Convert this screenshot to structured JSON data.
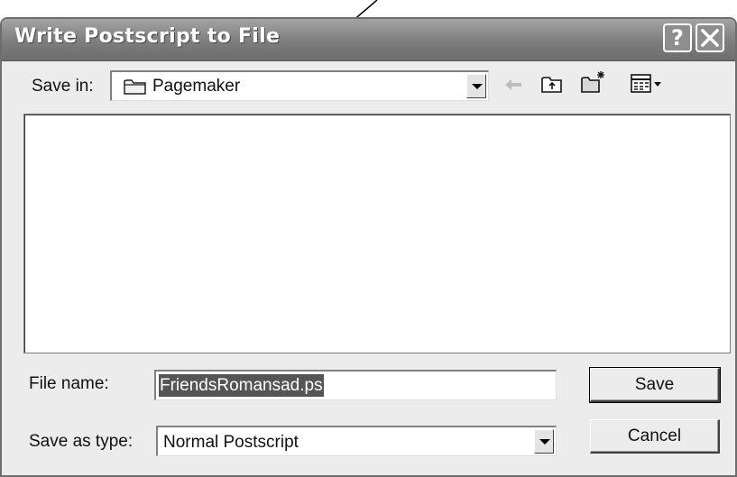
{
  "window": {
    "title": "Write Postscript to File",
    "help_label": "?"
  },
  "toolbar": {
    "save_in_label": "Save in:",
    "save_in_value": "Pagemaker",
    "icons": [
      "folder-icon",
      "back-arrow-icon",
      "up-one-level-icon",
      "create-new-folder-icon",
      "view-menu-icon"
    ]
  },
  "file_list": {
    "items": []
  },
  "form": {
    "file_name_label": "File name:",
    "file_name_value": "FriendsRomansad.ps",
    "save_as_type_label": "Save as type:",
    "save_as_type_value": "Normal Postscript"
  },
  "buttons": {
    "save": "Save",
    "cancel": "Cancel"
  }
}
